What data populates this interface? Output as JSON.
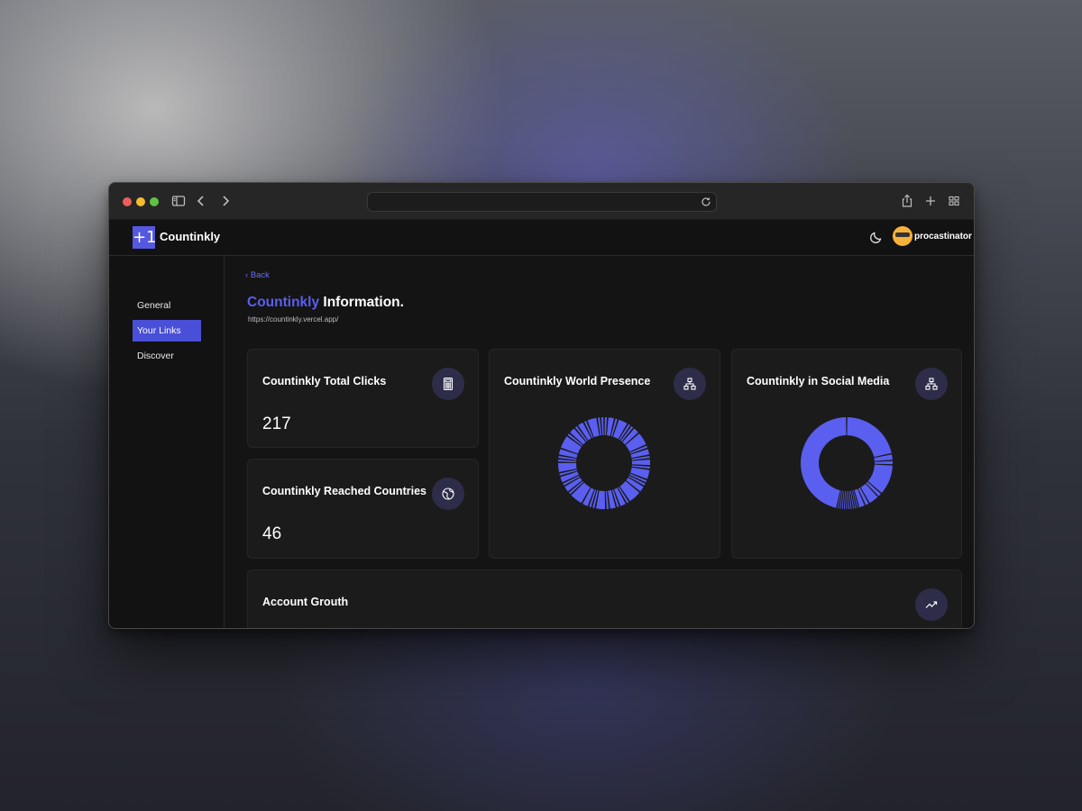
{
  "app": {
    "name": "Countinkly",
    "logo_mark": "+1",
    "user": "procastinator"
  },
  "sidebar": {
    "items": [
      {
        "label": "General",
        "active": false
      },
      {
        "label": "Your Links",
        "active": true
      },
      {
        "label": "Discover",
        "active": false
      }
    ]
  },
  "page": {
    "back_label": "Back",
    "title_accent": "Countinkly",
    "title_rest": "Information.",
    "url": "https://countinkly.vercel.app/"
  },
  "cards": {
    "total_clicks": {
      "title": "Countinkly Total Clicks",
      "value": "217",
      "icon": "calculator-icon"
    },
    "reached_countries": {
      "title": "Countinkly Reached Countries",
      "value": "46",
      "icon": "globe-icon"
    },
    "world_presence": {
      "title": "Countinkly World Presence",
      "icon": "network-icon"
    },
    "social_media": {
      "title": "Countinkly in Social Media",
      "icon": "network-icon"
    },
    "account_growth": {
      "title": "Account Grouth",
      "icon": "trending-up-icon"
    }
  },
  "colors": {
    "accent": "#5458e0",
    "donut": "#5a5ff0",
    "card_bg": "#1b1b1b"
  }
}
